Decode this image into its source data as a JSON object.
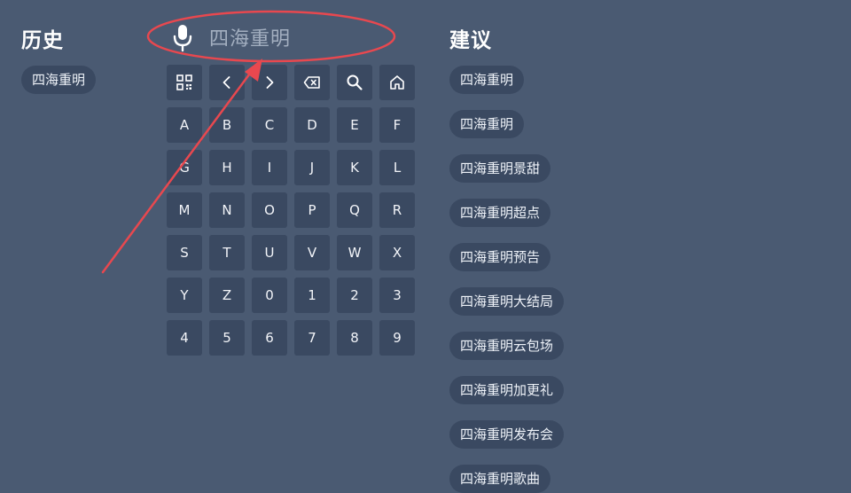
{
  "history": {
    "title": "历史",
    "items": [
      "四海重明"
    ]
  },
  "search": {
    "query": "四海重明",
    "mic_icon": "mic-icon"
  },
  "keyboard": {
    "function_keys": [
      {
        "icon": "qr-code-icon"
      },
      {
        "icon": "chevron-left-icon"
      },
      {
        "icon": "chevron-right-icon"
      },
      {
        "icon": "backspace-icon"
      },
      {
        "icon": "search-icon"
      },
      {
        "icon": "home-icon"
      }
    ],
    "keys": [
      "A",
      "B",
      "C",
      "D",
      "E",
      "F",
      "G",
      "H",
      "I",
      "J",
      "K",
      "L",
      "M",
      "N",
      "O",
      "P",
      "Q",
      "R",
      "S",
      "T",
      "U",
      "V",
      "W",
      "X",
      "Y",
      "Z",
      "0",
      "1",
      "2",
      "3",
      "4",
      "5",
      "6",
      "7",
      "8",
      "9"
    ]
  },
  "suggestions": {
    "title": "建议",
    "items": [
      "四海重明",
      "四海重明",
      "四海重明景甜",
      "四海重明超点",
      "四海重明预告",
      "四海重明大结局",
      "四海重明云包场",
      "四海重明加更礼",
      "四海重明发布会",
      "四海重明歌曲"
    ]
  },
  "annotation_color": "#e8484f"
}
